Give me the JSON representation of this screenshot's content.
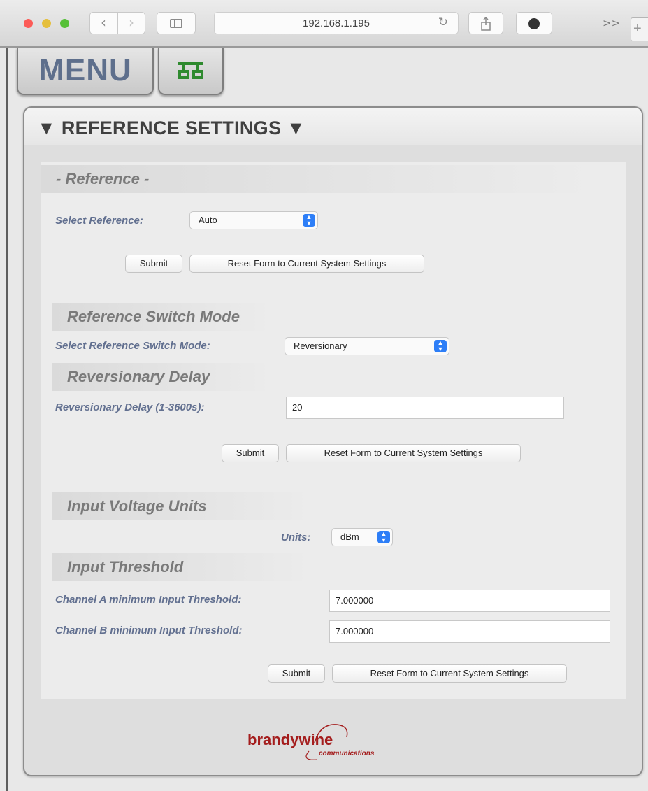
{
  "browser": {
    "address": "192.168.1.195",
    "back_icon": "‹",
    "forward_icon": "›",
    "reload_icon": "↻",
    "overflow_icon": ">>",
    "newtab_icon": "+"
  },
  "nav": {
    "menu_label": "MENU",
    "network_icon": "network-icon"
  },
  "panel": {
    "title": "▼ REFERENCE SETTINGS ▼"
  },
  "reference": {
    "heading": "- Reference -",
    "select_label": "Select Reference:",
    "select_value": "Auto",
    "submit": "Submit",
    "reset": "Reset Form to Current System Settings"
  },
  "switch_mode": {
    "heading": "Reference Switch Mode",
    "select_label": "Select Reference Switch Mode:",
    "select_value": "Reversionary",
    "delay_heading": "Reversionary Delay",
    "delay_label": "Reversionary Delay (1-3600s):",
    "delay_value": "20",
    "submit": "Submit",
    "reset": "Reset Form to Current System Settings"
  },
  "input": {
    "units_heading": "Input Voltage Units",
    "units_label": "Units:",
    "units_value": "dBm",
    "threshold_heading": "Input Threshold",
    "channel_a_label": "Channel A minimum Input Threshold:",
    "channel_a_value": "7.000000",
    "channel_b_label": "Channel B minimum Input Threshold:",
    "channel_b_value": "7.000000",
    "submit": "Submit",
    "reset": "Reset Form to Current System Settings"
  },
  "footer": {
    "logo_main": "brandywine",
    "logo_sub": "communications"
  },
  "colors": {
    "label": "#627090",
    "menu_text": "#5e6f8c",
    "network_icon": "#2f8a2f",
    "logo": "#a41d1d",
    "select_arrow": "#2d7ef7"
  }
}
